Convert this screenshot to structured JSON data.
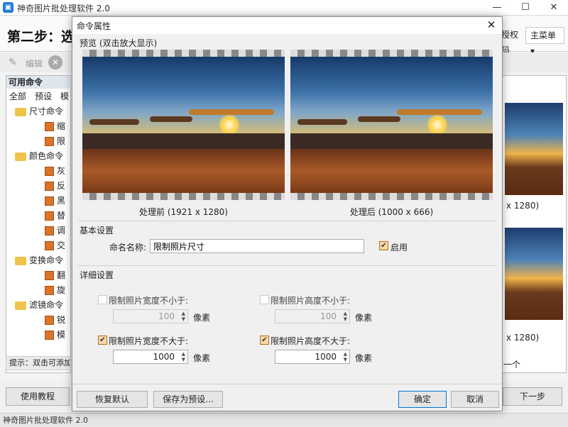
{
  "app": {
    "title": "神奇图片批处理软件 2.0",
    "icon": "app-logo-icon",
    "step_title": "第二步：选",
    "header_buttons": [
      "授权码",
      "主菜单▾"
    ],
    "toolbar": {
      "edit_label": "编辑"
    },
    "left_panel": {
      "title": "可用命令",
      "tabs": [
        "全部",
        "预设",
        "模"
      ],
      "tree": [
        {
          "label": "尺寸命令",
          "children": [
            "缩",
            "限"
          ]
        },
        {
          "label": "颜色命令",
          "children": [
            "灰",
            "反",
            "黑",
            "替",
            "调",
            "交"
          ]
        },
        {
          "label": "变换命令",
          "children": [
            "翻",
            "旋"
          ]
        },
        {
          "label": "滤镜命令",
          "children": [
            "锐",
            "模"
          ]
        }
      ]
    },
    "hint": "提示：双击可添加",
    "right_panel": {
      "title": "",
      "captions": [
        "x 1280)",
        "x 1280)"
      ],
      "footer": "一个"
    },
    "bottom": {
      "tutorial_button": "使用教程",
      "next_button": "下一步"
    },
    "statusbar": "神奇图片批处理软件 2.0",
    "window_controls": [
      "—",
      "☐",
      "✕"
    ]
  },
  "dialog": {
    "title": "命令属性",
    "close": "✕",
    "preview_group": "预览 (双击放大显示)",
    "before_caption": "处理前 (1921 x 1280)",
    "after_caption": "处理后 (1000 x 666)",
    "basic_group": "基本设置",
    "name_label": "命名名称:",
    "name_value": "限制照片尺寸",
    "enable_label": "启用",
    "enable_checked": true,
    "detail_group": "详细设置",
    "options": [
      {
        "label": "限制照片宽度不小于:",
        "checked": false,
        "value": "100",
        "unit": "像素"
      },
      {
        "label": "限制照片高度不小于:",
        "checked": false,
        "value": "100",
        "unit": "像素"
      },
      {
        "label": "限制照片宽度不大于:",
        "checked": true,
        "value": "1000",
        "unit": "像素"
      },
      {
        "label": "限制照片高度不大于:",
        "checked": true,
        "value": "1000",
        "unit": "像素"
      }
    ],
    "buttons": {
      "reset": "恢复默认",
      "save_preset": "保存为预设...",
      "ok": "确定",
      "cancel": "取消"
    }
  }
}
